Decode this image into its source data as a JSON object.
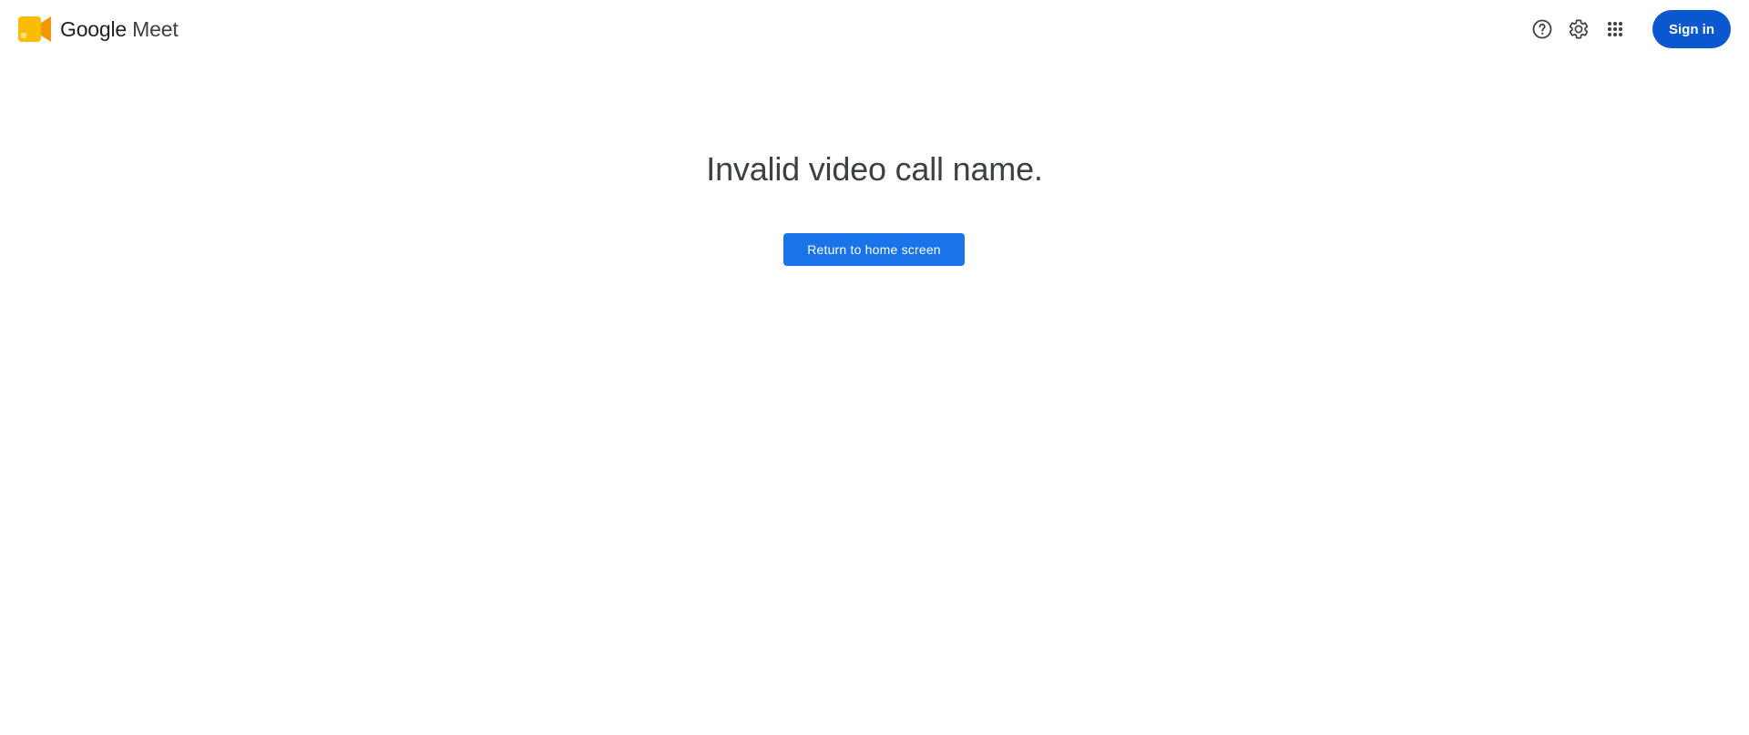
{
  "header": {
    "brand": {
      "google": "Google",
      "product": "Meet",
      "logo_icon": "google-meet-logo-icon"
    },
    "help_icon": "help-circle-icon",
    "settings_icon": "gear-icon",
    "apps_icon": "apps-grid-icon",
    "sign_in_label": "Sign in"
  },
  "main": {
    "title": "Invalid video call name.",
    "return_button_label": "Return to home screen"
  },
  "colors": {
    "primary_blue": "#1a73e8",
    "sign_in_blue": "#0b57d0",
    "text_dark": "#3c4043",
    "logo_yellow": "#fbbc04",
    "logo_orange": "#f29900"
  }
}
